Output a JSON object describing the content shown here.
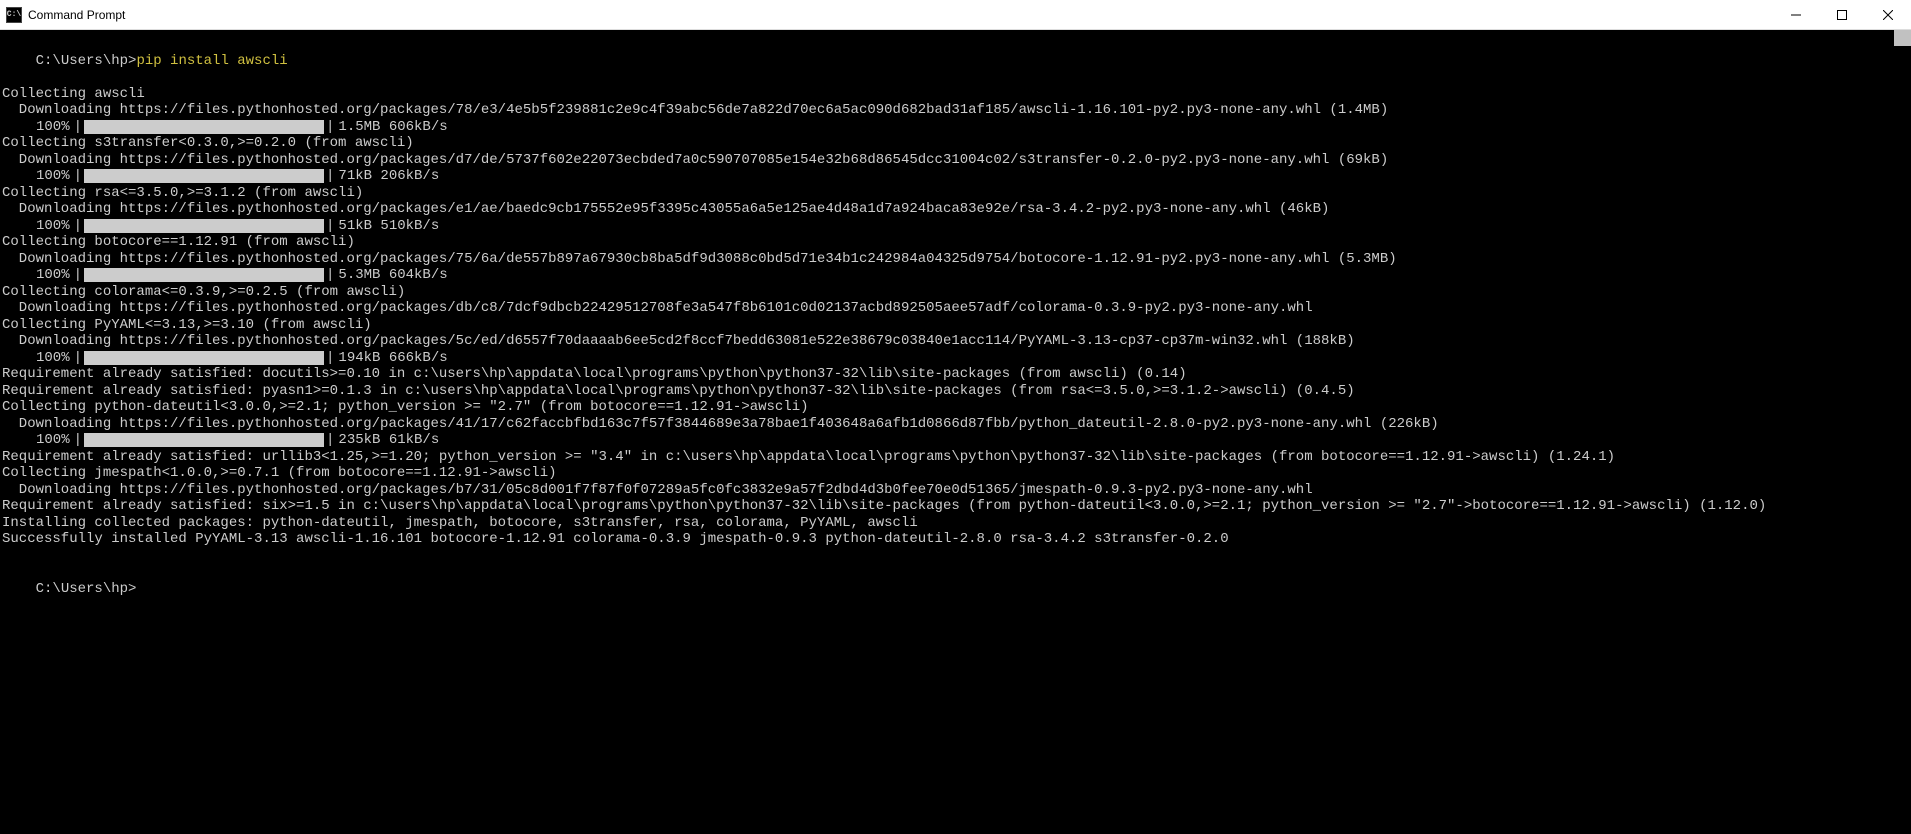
{
  "window": {
    "title": "Command Prompt",
    "icon_label": "C:\\"
  },
  "prompt": {
    "path": "C:\\Users\\hp>",
    "command": "pip install awscli",
    "final_path": "C:\\Users\\hp>"
  },
  "lines": [
    {
      "t": "text",
      "v": "Collecting awscli"
    },
    {
      "t": "text",
      "v": "  Downloading https://files.pythonhosted.org/packages/78/e3/4e5b5f239881c2e9c4f39abc56de7a822d70ec6a5ac090d682bad31af185/awscli-1.16.101-py2.py3-none-any.whl (1.4MB)"
    },
    {
      "t": "prog",
      "pct": "100%",
      "bar": 240,
      "rate": "1.5MB 606kB/s"
    },
    {
      "t": "text",
      "v": "Collecting s3transfer<0.3.0,>=0.2.0 (from awscli)"
    },
    {
      "t": "text",
      "v": "  Downloading https://files.pythonhosted.org/packages/d7/de/5737f602e22073ecbded7a0c590707085e154e32b68d86545dcc31004c02/s3transfer-0.2.0-py2.py3-none-any.whl (69kB)"
    },
    {
      "t": "prog",
      "pct": "100%",
      "bar": 240,
      "rate": "71kB 206kB/s"
    },
    {
      "t": "text",
      "v": "Collecting rsa<=3.5.0,>=3.1.2 (from awscli)"
    },
    {
      "t": "text",
      "v": "  Downloading https://files.pythonhosted.org/packages/e1/ae/baedc9cb175552e95f3395c43055a6a5e125ae4d48a1d7a924baca83e92e/rsa-3.4.2-py2.py3-none-any.whl (46kB)"
    },
    {
      "t": "prog",
      "pct": "100%",
      "bar": 240,
      "rate": "51kB 510kB/s"
    },
    {
      "t": "text",
      "v": "Collecting botocore==1.12.91 (from awscli)"
    },
    {
      "t": "text",
      "v": "  Downloading https://files.pythonhosted.org/packages/75/6a/de557b897a67930cb8ba5df9d3088c0bd5d71e34b1c242984a04325d9754/botocore-1.12.91-py2.py3-none-any.whl (5.3MB)"
    },
    {
      "t": "prog",
      "pct": "100%",
      "bar": 240,
      "rate": "5.3MB 604kB/s"
    },
    {
      "t": "text",
      "v": "Collecting colorama<=0.3.9,>=0.2.5 (from awscli)"
    },
    {
      "t": "text",
      "v": "  Downloading https://files.pythonhosted.org/packages/db/c8/7dcf9dbcb22429512708fe3a547f8b6101c0d02137acbd892505aee57adf/colorama-0.3.9-py2.py3-none-any.whl"
    },
    {
      "t": "text",
      "v": "Collecting PyYAML<=3.13,>=3.10 (from awscli)"
    },
    {
      "t": "text",
      "v": "  Downloading https://files.pythonhosted.org/packages/5c/ed/d6557f70daaaab6ee5cd2f8ccf7bedd63081e522e38679c03840e1acc114/PyYAML-3.13-cp37-cp37m-win32.whl (188kB)"
    },
    {
      "t": "prog",
      "pct": "100%",
      "bar": 240,
      "rate": "194kB 666kB/s"
    },
    {
      "t": "text",
      "v": "Requirement already satisfied: docutils>=0.10 in c:\\users\\hp\\appdata\\local\\programs\\python\\python37-32\\lib\\site-packages (from awscli) (0.14)"
    },
    {
      "t": "text",
      "v": "Requirement already satisfied: pyasn1>=0.1.3 in c:\\users\\hp\\appdata\\local\\programs\\python\\python37-32\\lib\\site-packages (from rsa<=3.5.0,>=3.1.2->awscli) (0.4.5)"
    },
    {
      "t": "text",
      "v": "Collecting python-dateutil<3.0.0,>=2.1; python_version >= \"2.7\" (from botocore==1.12.91->awscli)"
    },
    {
      "t": "text",
      "v": "  Downloading https://files.pythonhosted.org/packages/41/17/c62faccbfbd163c7f57f3844689e3a78bae1f403648a6afb1d0866d87fbb/python_dateutil-2.8.0-py2.py3-none-any.whl (226kB)"
    },
    {
      "t": "prog",
      "pct": "100%",
      "bar": 240,
      "rate": "235kB 61kB/s"
    },
    {
      "t": "text",
      "v": "Requirement already satisfied: urllib3<1.25,>=1.20; python_version >= \"3.4\" in c:\\users\\hp\\appdata\\local\\programs\\python\\python37-32\\lib\\site-packages (from botocore==1.12.91->awscli) (1.24.1)"
    },
    {
      "t": "text",
      "v": "Collecting jmespath<1.0.0,>=0.7.1 (from botocore==1.12.91->awscli)"
    },
    {
      "t": "text",
      "v": "  Downloading https://files.pythonhosted.org/packages/b7/31/05c8d001f7f87f0f07289a5fc0fc3832e9a57f2dbd4d3b0fee70e0d51365/jmespath-0.9.3-py2.py3-none-any.whl"
    },
    {
      "t": "text",
      "v": "Requirement already satisfied: six>=1.5 in c:\\users\\hp\\appdata\\local\\programs\\python\\python37-32\\lib\\site-packages (from python-dateutil<3.0.0,>=2.1; python_version >= \"2.7\"->botocore==1.12.91->awscli) (1.12.0)"
    },
    {
      "t": "text",
      "v": "Installing collected packages: python-dateutil, jmespath, botocore, s3transfer, rsa, colorama, PyYAML, awscli"
    },
    {
      "t": "text",
      "v": "Successfully installed PyYAML-3.13 awscli-1.16.101 botocore-1.12.91 colorama-0.3.9 jmespath-0.9.3 python-dateutil-2.8.0 rsa-3.4.2 s3transfer-0.2.0"
    }
  ]
}
